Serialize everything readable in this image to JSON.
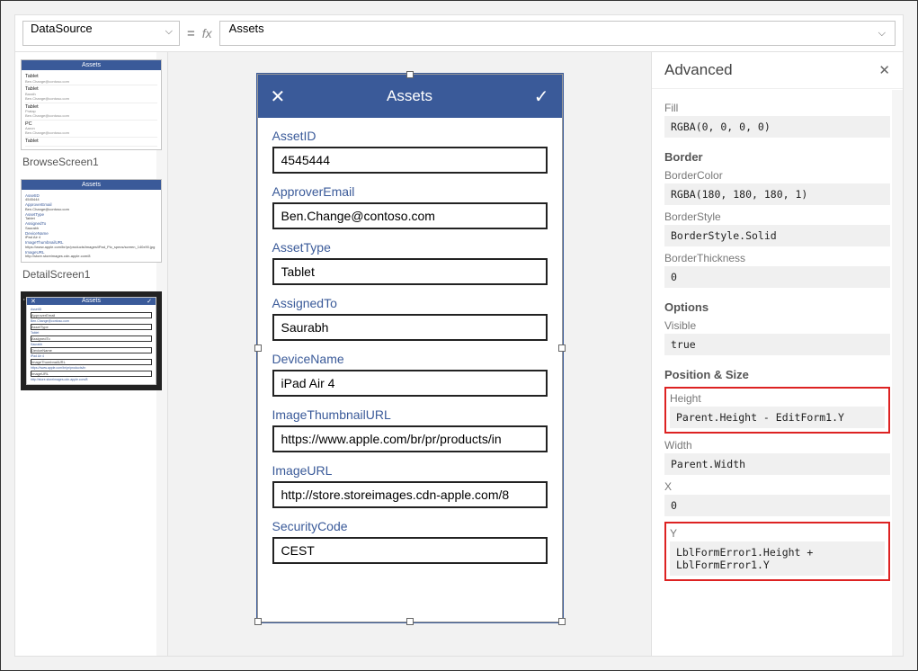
{
  "formula_bar": {
    "property": "DataSource",
    "equals": "=",
    "fx": "fx",
    "expression": "Assets"
  },
  "thumbs": {
    "browse": {
      "title": "Assets",
      "rows": [
        {
          "name": "Tablet",
          "sub": "Ben.Change@contoso.com"
        },
        {
          "name": "Tablet",
          "sub": "Ben.Change@contoso.com",
          "extra": "Barath"
        },
        {
          "name": "Tablet",
          "sub": "Ben.Change@contoso.com",
          "extra": "Pratap"
        },
        {
          "name": "PC",
          "sub": "Ben.Change@contoso.com",
          "extra": "Aaron"
        },
        {
          "name": "Tablet",
          "sub": ""
        }
      ],
      "label": "BrowseScreen1"
    },
    "detail": {
      "title": "Assets",
      "fields": [
        "AssetID",
        "4545444",
        "ApproverEmail",
        "Ben.Change@contoso.com",
        "AssetType",
        "Tablet",
        "AssignedTo",
        "Saurabh",
        "DeviceName",
        "iPad Air 4",
        "ImageThumbnailURL",
        "https://www.apple.com/br/pr/products/images/iPad_Pic_specs/screen_140x90.jpg",
        "ImageURL",
        "http://store.storeimages.cdn-apple.com/8"
      ],
      "label": "DetailScreen1"
    },
    "edit": {
      "title": "Assets",
      "fields": [
        "AssetID",
        "ApproverEmail",
        "Ben.Change@contoso.com",
        "AssetType",
        "Tablet",
        "AssignedTo",
        "Saurabh",
        "DeviceName",
        "iPad Air 4",
        "ImageThumbnailURL",
        "https://www.apple.com/br/pr/products/in",
        "ImageURL",
        "http://store.storeimages.cdn-apple.com/8"
      ]
    }
  },
  "phone_form": {
    "title": "Assets",
    "close_icon": "close-icon",
    "accept_icon": "check-icon",
    "fields": [
      {
        "label": "AssetID",
        "value": "4545444"
      },
      {
        "label": "ApproverEmail",
        "value": "Ben.Change@contoso.com"
      },
      {
        "label": "AssetType",
        "value": "Tablet"
      },
      {
        "label": "AssignedTo",
        "value": "Saurabh"
      },
      {
        "label": "DeviceName",
        "value": "iPad Air 4"
      },
      {
        "label": "ImageThumbnailURL",
        "value": "https://www.apple.com/br/pr/products/in"
      },
      {
        "label": "ImageURL",
        "value": "http://store.storeimages.cdn-apple.com/8"
      },
      {
        "label": "SecurityCode",
        "value": "CEST"
      }
    ]
  },
  "advanced": {
    "title": "Advanced",
    "items": [
      {
        "section": null,
        "label": "Fill",
        "value": "RGBA(0, 0, 0, 0)",
        "partial": true
      },
      {
        "section": "Border",
        "label": "BorderColor",
        "value": "RGBA(180, 180, 180, 1)"
      },
      {
        "section": null,
        "label": "BorderStyle",
        "value": "BorderStyle.Solid"
      },
      {
        "section": null,
        "label": "BorderThickness",
        "value": "0"
      },
      {
        "section": "Options",
        "label": "Visible",
        "value": "true"
      },
      {
        "section": "Position & Size",
        "label": "Height",
        "value": "Parent.Height - EditForm1.Y",
        "highlight": true
      },
      {
        "section": null,
        "label": "Width",
        "value": "Parent.Width"
      },
      {
        "section": null,
        "label": "X",
        "value": "0"
      },
      {
        "section": null,
        "label": "Y",
        "value": "LblFormError1.Height + LblFormError1.Y",
        "highlight": true
      }
    ]
  }
}
